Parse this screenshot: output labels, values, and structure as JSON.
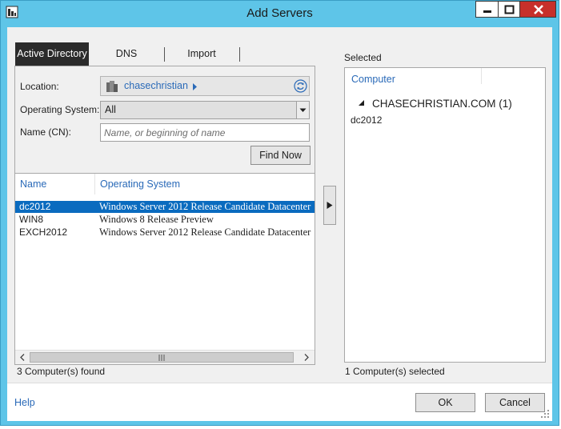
{
  "window": {
    "title": "Add Servers"
  },
  "tabs": [
    {
      "label": "Active Directory",
      "active": true
    },
    {
      "label": "DNS",
      "active": false
    },
    {
      "label": "Import",
      "active": false
    }
  ],
  "search": {
    "location_label": "Location:",
    "location_value": "chasechristian",
    "os_label": "Operating System:",
    "os_value": "All",
    "name_label": "Name (CN):",
    "name_placeholder": "Name, or beginning of name",
    "find_now": "Find Now"
  },
  "results": {
    "columns": [
      "Name",
      "Operating System"
    ],
    "rows": [
      {
        "name": "dc2012",
        "os": "Windows Server 2012 Release Candidate Datacenter",
        "selected": true
      },
      {
        "name": "WIN8",
        "os": "Windows 8 Release Preview",
        "selected": false
      },
      {
        "name": "EXCH2012",
        "os": "Windows Server 2012 Release Candidate Datacenter",
        "selected": false
      }
    ],
    "count_text": "3 Computer(s) found"
  },
  "selected": {
    "label": "Selected",
    "column": "Computer",
    "group": "CHASECHRISTIAN.COM (1)",
    "items": [
      "dc2012"
    ],
    "count_text": "1 Computer(s) selected"
  },
  "footer": {
    "help": "Help",
    "ok": "OK",
    "cancel": "Cancel"
  },
  "icons": {
    "app": "server-manager-icon",
    "location": "domain-icon",
    "refresh": "refresh-icon",
    "add": "arrow-right-icon"
  },
  "colors": {
    "title_bar": "#5ec5e8",
    "accent": "#2a6ab8",
    "selection": "#0a6bbf",
    "close": "#c7302b",
    "active_tab": "#2b2b2b"
  }
}
